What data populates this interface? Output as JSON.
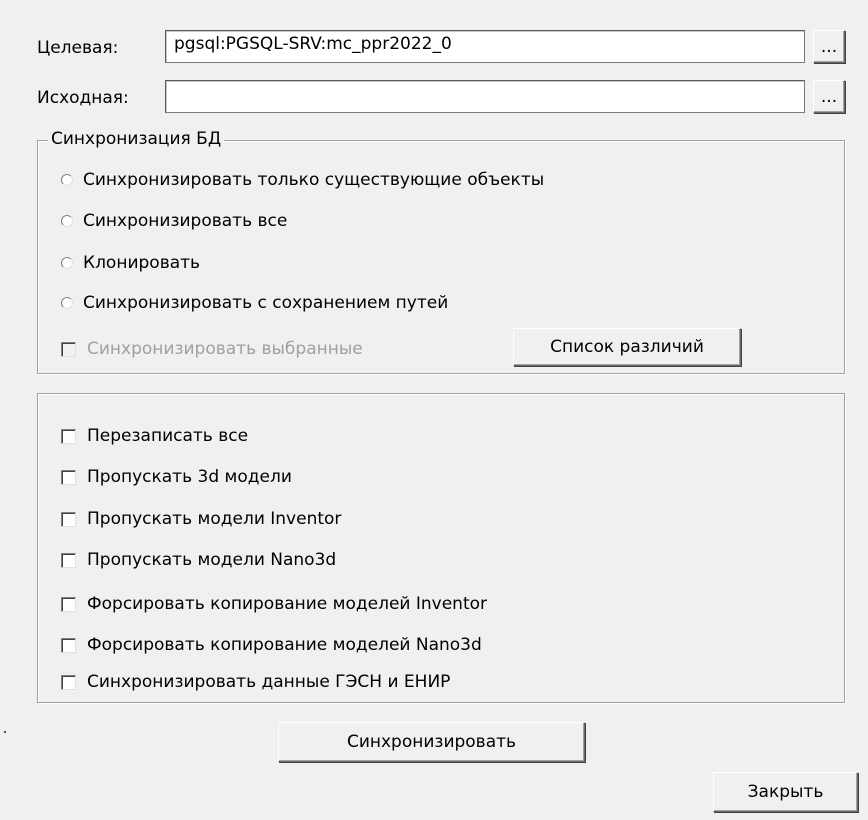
{
  "target": {
    "label": "Целевая:",
    "value": "pgsql:PGSQL-SRV:mc_ppr2022_0",
    "browse": "..."
  },
  "source": {
    "label": "Исходная:",
    "value": "",
    "browse": "..."
  },
  "sync_group": {
    "title": "Синхронизация БД",
    "options": [
      "Синхронизировать только существующие объекты",
      "Синхронизировать все",
      "Клонировать",
      "Синхронизировать с сохранением путей"
    ],
    "sync_selected": "Синхронизировать выбранные",
    "diff_button": "Список различий"
  },
  "options_group": {
    "items": [
      "Перезаписать все",
      "Пропускать 3d модели",
      "Пропускать модели Inventor",
      "Пропускать модели Nano3d",
      "Форсировать копирование моделей Inventor",
      "Форсировать копирование моделей Nano3d",
      "Синхронизировать данные ГЭСН и ЕНИР"
    ]
  },
  "buttons": {
    "sync": "Синхронизировать",
    "close": "Закрыть"
  }
}
